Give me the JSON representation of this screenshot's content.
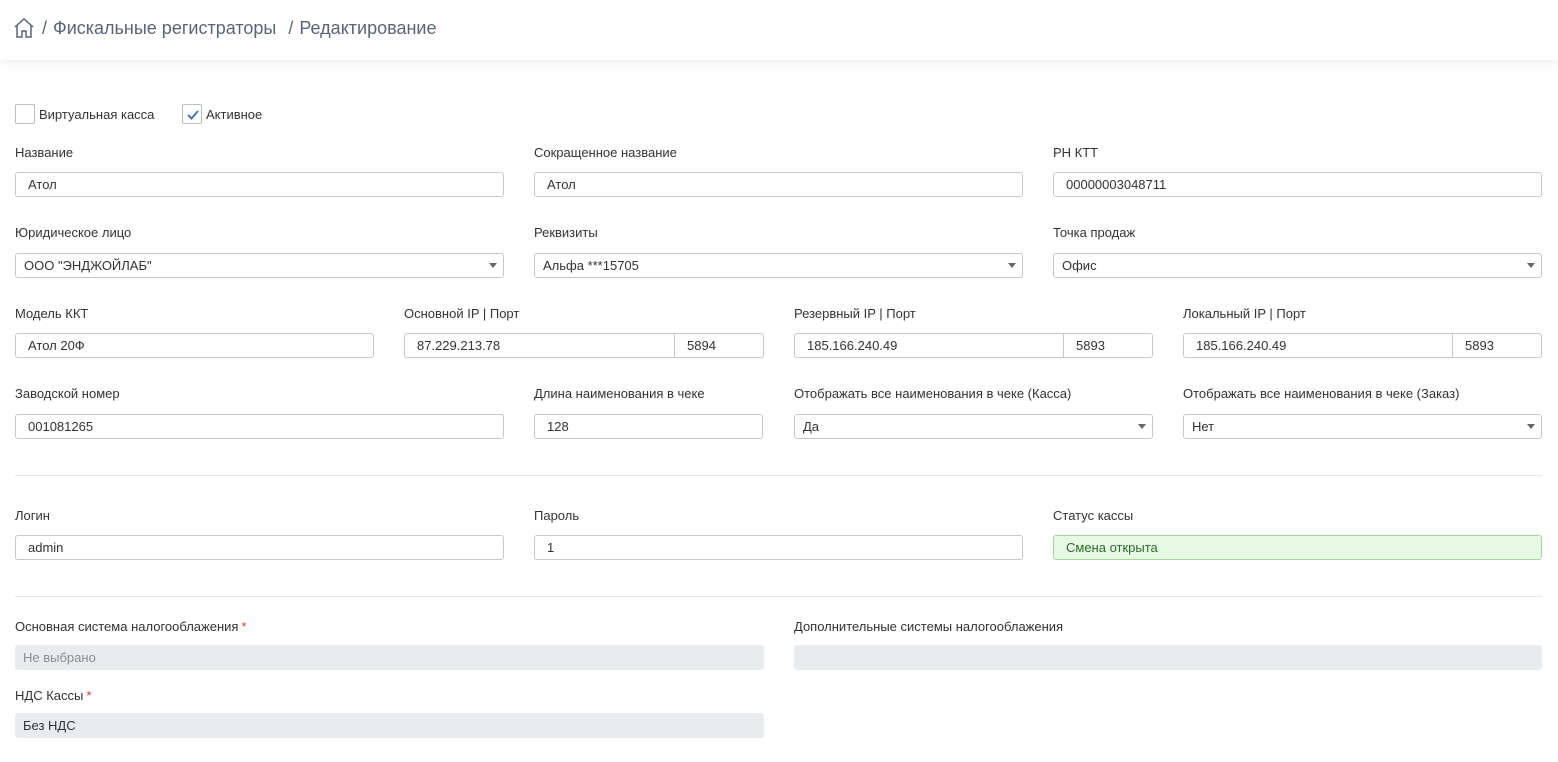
{
  "breadcrumb": {
    "home_icon": "home-icon",
    "separator": "/",
    "section": "Фискальные регистраторы",
    "page": "Редактирование"
  },
  "checkboxes": {
    "virtual": {
      "label": "Виртуальная касса",
      "checked": false
    },
    "active": {
      "label": "Активное",
      "checked": true
    }
  },
  "fields": {
    "name": {
      "label": "Название",
      "value": "Атол"
    },
    "short_name": {
      "label": "Сокращенное название",
      "value": "Атол"
    },
    "rn_ktt": {
      "label": "РН КТТ",
      "value": "00000003048711"
    },
    "legal_entity": {
      "label": "Юридическое лицо",
      "value": "ООО \"ЭНДЖОЙЛАБ\""
    },
    "requisites": {
      "label": "Реквизиты",
      "value": "Альфа ***15705"
    },
    "point_of_sale": {
      "label": "Точка продаж",
      "value": "Офис"
    },
    "kkt_model": {
      "label": "Модель ККТ",
      "value": "Атол 20Ф"
    },
    "main_ip": {
      "label": "Основной IP | Порт",
      "ip": "87.229.213.78",
      "port": "5894"
    },
    "reserve_ip": {
      "label": "Резервный IP | Порт",
      "ip": "185.166.240.49",
      "port": "5893"
    },
    "local_ip": {
      "label": "Локальный IP | Порт",
      "ip": "185.166.240.49",
      "port": "5893"
    },
    "serial": {
      "label": "Заводской номер",
      "value": "001081265"
    },
    "name_length": {
      "label": "Длина наименования в чеке",
      "value": "128"
    },
    "show_names_kassa": {
      "label": "Отображать все наименования в чеке (Касса)",
      "value": "Да"
    },
    "show_names_order": {
      "label": "Отображать все наименования в чеке (Заказ)",
      "value": "Нет"
    },
    "login": {
      "label": "Логин",
      "value": "admin"
    },
    "password": {
      "label": "Пароль",
      "value": "1"
    },
    "status": {
      "label": "Статус кассы",
      "value": "Смена открыта"
    },
    "tax_main": {
      "label": "Основная система налогооблажения",
      "required_mark": "*",
      "value": "Не выбрано"
    },
    "tax_extra": {
      "label": "Дополнительные системы налогооблажения",
      "value": ""
    },
    "vat": {
      "label": "НДС Кассы",
      "required_mark": "*",
      "value": "Без НДС"
    }
  },
  "colors": {
    "status_bg": "#e7f9e5",
    "required": "#e53935",
    "disabled_bg": "#e9ecef"
  }
}
